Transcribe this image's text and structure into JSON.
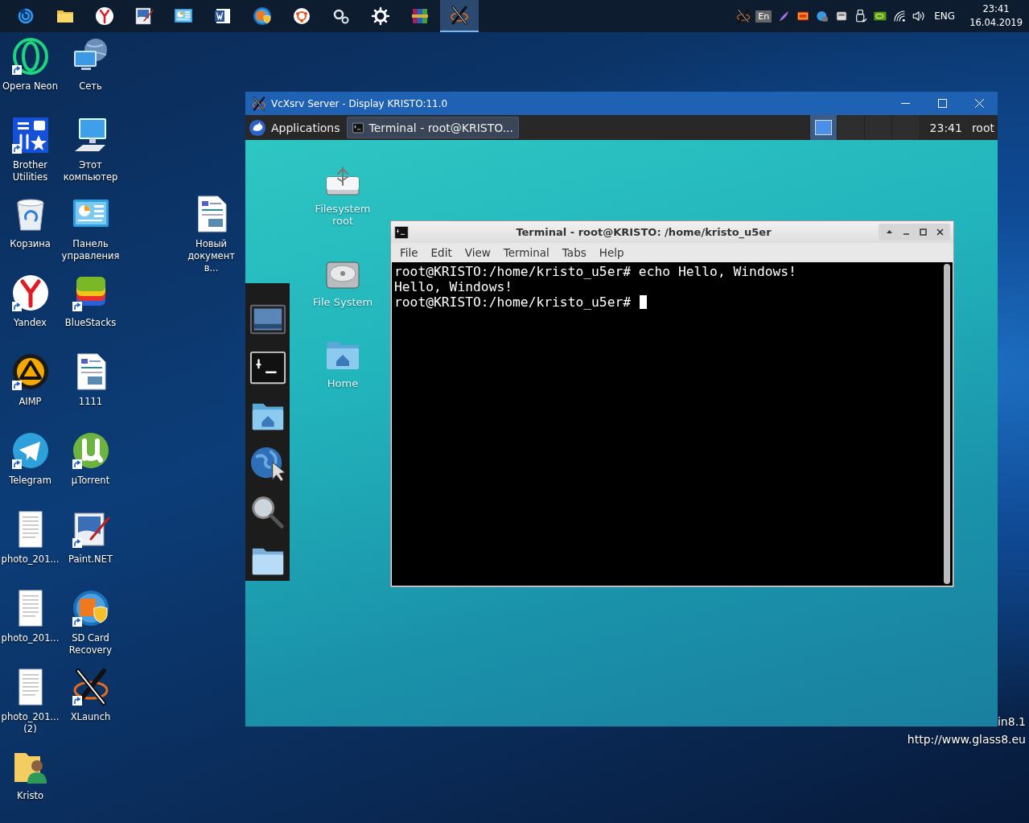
{
  "taskbar": {
    "apps": [
      {
        "kind": "swirl",
        "selected": false
      },
      {
        "kind": "folder",
        "selected": false
      },
      {
        "kind": "yandex",
        "selected": false
      },
      {
        "kind": "paint",
        "selected": false
      },
      {
        "kind": "control-panel",
        "selected": false
      },
      {
        "kind": "word",
        "selected": false
      },
      {
        "kind": "sdcard",
        "selected": false
      },
      {
        "kind": "ubuntu",
        "selected": false
      },
      {
        "kind": "gears",
        "selected": false
      },
      {
        "kind": "gear",
        "selected": false
      },
      {
        "kind": "archive",
        "selected": false
      },
      {
        "kind": "xlaunch",
        "selected": true
      }
    ],
    "tray": [
      {
        "kind": "xlaunch"
      },
      {
        "kind": "lang-box",
        "label": "En"
      },
      {
        "kind": "feather"
      },
      {
        "kind": "cc"
      },
      {
        "kind": "cloud"
      },
      {
        "kind": "drive"
      },
      {
        "kind": "usb"
      },
      {
        "kind": "nvidia"
      },
      {
        "kind": "wifi"
      },
      {
        "kind": "volume"
      }
    ],
    "language": "ENG",
    "time": "23:41",
    "date": "16.04.2019"
  },
  "desktop_icons": [
    {
      "kind": "opera",
      "label": "Opera Neon",
      "shortcut": true
    },
    {
      "kind": "brother",
      "label": "Brother Utilities",
      "shortcut": true
    },
    {
      "kind": "recycle",
      "label": "Корзина",
      "shortcut": false
    },
    {
      "kind": "yandex",
      "label": "Yandex",
      "shortcut": true
    },
    {
      "kind": "aimp",
      "label": "AIMP",
      "shortcut": true
    },
    {
      "kind": "telegram",
      "label": "Telegram",
      "shortcut": true
    },
    {
      "kind": "text-page",
      "label": "photo_201...",
      "shortcut": false
    },
    {
      "kind": "text-page",
      "label": "photo_201...",
      "shortcut": false
    },
    {
      "kind": "text-page",
      "label": "photo_201... (2)",
      "shortcut": false
    },
    {
      "kind": "user-folder",
      "label": "Kristo",
      "shortcut": false
    },
    {
      "kind": "network",
      "label": "Сеть",
      "shortcut": false
    },
    {
      "kind": "computer",
      "label": "Этот компьютер",
      "shortcut": false
    },
    {
      "kind": "control-panel",
      "label": "Панель управления",
      "shortcut": false
    },
    {
      "kind": "bluestacks",
      "label": "BlueStacks",
      "shortcut": true
    },
    {
      "kind": "document",
      "label": "1111",
      "shortcut": false
    },
    {
      "kind": "utorrent",
      "label": "µTorrent",
      "shortcut": true
    },
    {
      "kind": "paint",
      "label": "Paint.NET",
      "shortcut": true
    },
    {
      "kind": "sdcard",
      "label": "SD Card Recovery",
      "shortcut": true
    },
    {
      "kind": "xlaunch",
      "label": "XLaunch",
      "shortcut": true
    }
  ],
  "desktop_file": {
    "kind": "document",
    "label": "Новый документ в...",
    "shortcut": false
  },
  "desktop_text": [
    "in8.1",
    "http://www.glass8.eu"
  ],
  "xserver_window": {
    "title": "VcXsrv Server - Display KRISTO:11.0",
    "panel": {
      "menu": "Applications",
      "task": "Terminal - root@KRISTO...",
      "workspaces": [
        {
          "selected": true
        },
        {
          "selected": false
        },
        {
          "selected": false
        },
        {
          "selected": false
        }
      ],
      "clock": "23:41",
      "user": "root"
    },
    "desktop_icons": [
      {
        "kind": "usb-drive",
        "label": "Filesystem root"
      },
      {
        "kind": "hdd",
        "label": "File System"
      },
      {
        "kind": "home",
        "label": "Home"
      }
    ],
    "dock": [
      {
        "kind": "desktop"
      },
      {
        "kind": "terminal"
      },
      {
        "kind": "home"
      },
      {
        "kind": "globe"
      },
      {
        "kind": "magnifier"
      },
      {
        "kind": "folder-blue"
      }
    ],
    "terminal": {
      "title": "Terminal - root@KRISTO: /home/kristo_u5er",
      "menu": [
        "File",
        "Edit",
        "View",
        "Terminal",
        "Tabs",
        "Help"
      ],
      "lines": [
        "root@KRISTO:/home/kristo_u5er# echo Hello, Windows!",
        "Hello, Windows!",
        "root@KRISTO:/home/kristo_u5er#"
      ]
    }
  }
}
